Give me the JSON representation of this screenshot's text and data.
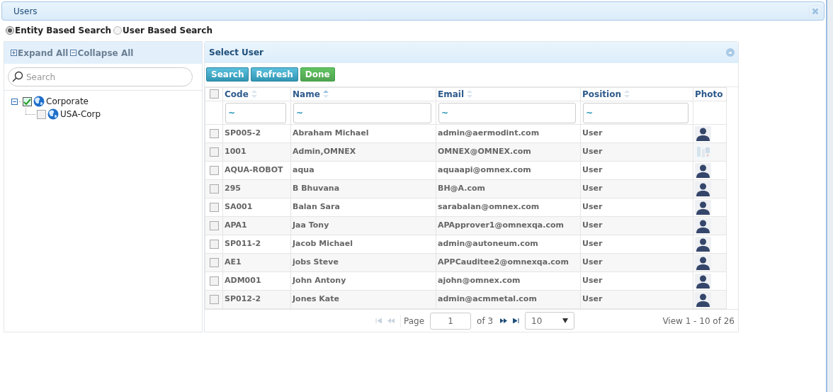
{
  "window": {
    "title": "Users"
  },
  "search_modes": [
    {
      "label": "Entity Based Search",
      "selected": true
    },
    {
      "label": "User Based Search",
      "selected": false
    }
  ],
  "tree_panel": {
    "expand_all": "Expand All",
    "collapse_all": "Collapse All",
    "search": {
      "placeholder": "Search"
    },
    "nodes": [
      {
        "label": "Corporate",
        "checked": true,
        "expanded": true,
        "children": [
          {
            "label": "USA-Corp",
            "checked": false
          }
        ]
      }
    ]
  },
  "user_panel": {
    "title": "Select User",
    "buttons": [
      {
        "label": "Search",
        "kind": "info"
      },
      {
        "label": "Refresh",
        "kind": "info"
      },
      {
        "label": "Done",
        "kind": "success"
      }
    ],
    "select_all_checked": false,
    "columns": [
      {
        "label": "Code",
        "sortable": true,
        "sorted": false,
        "filter": "~"
      },
      {
        "label": "Name",
        "sortable": true,
        "sorted": true,
        "filter": "~"
      },
      {
        "label": "Email",
        "sortable": true,
        "sorted": false,
        "filter": "~"
      },
      {
        "label": "Position",
        "sortable": true,
        "sorted": false,
        "filter": "~"
      },
      {
        "label": "Photo",
        "sortable": false
      }
    ],
    "rows": [
      {
        "checked": false,
        "code": "SP005-2",
        "name": "Abraham Michael",
        "email": "admin@aermodint.com",
        "position": "User",
        "default_avatar": true
      },
      {
        "checked": false,
        "code": "1001",
        "name": "Admin,OMNEX",
        "email": "OMNEX@OMNEX.com",
        "position": "User",
        "default_avatar": false
      },
      {
        "checked": false,
        "code": "AQUA-ROBOT",
        "name": "aqua",
        "email": "aquaapi@omnex.com",
        "position": "User",
        "default_avatar": true
      },
      {
        "checked": false,
        "code": "295",
        "name": "B Bhuvana",
        "email": "BH@A.com",
        "position": "User",
        "default_avatar": true
      },
      {
        "checked": false,
        "code": "SA001",
        "name": "Balan Sara",
        "email": "sarabalan@omnex.com",
        "position": "User",
        "default_avatar": true
      },
      {
        "checked": false,
        "code": "APA1",
        "name": "Jaa Tony",
        "email": "APApprover1@omnexqa.com",
        "position": "User",
        "default_avatar": true
      },
      {
        "checked": false,
        "code": "SP011-2",
        "name": "Jacob Michael",
        "email": "admin@autoneum.com",
        "position": "User",
        "default_avatar": true
      },
      {
        "checked": false,
        "code": "AE1",
        "name": "jobs Steve",
        "email": "APPCauditee2@omnexqa.com",
        "position": "User",
        "default_avatar": true
      },
      {
        "checked": false,
        "code": "ADM001",
        "name": "John Antony",
        "email": "ajohn@omnex.com",
        "position": "User",
        "default_avatar": true
      },
      {
        "checked": false,
        "code": "SP012-2",
        "name": "Jones Kate",
        "email": "admin@acmmetal.com",
        "position": "User",
        "default_avatar": true
      }
    ],
    "pager": {
      "page_label": "Page",
      "page": "1",
      "of_pages": "of 3",
      "page_size": "10",
      "summary": "View 1 - 10 of 26"
    }
  }
}
